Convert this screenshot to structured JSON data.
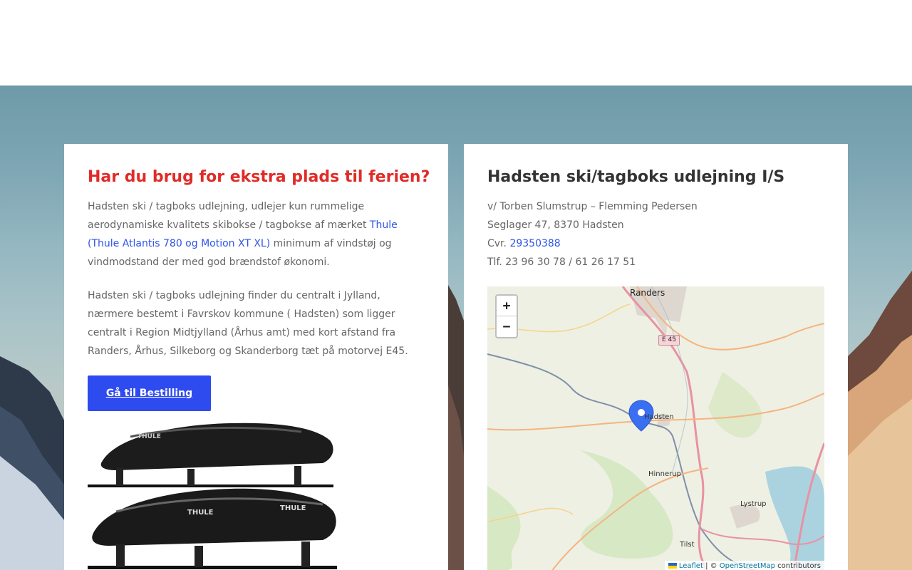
{
  "left_card": {
    "title": "Har du brug for ekstra plads til ferien?",
    "p1_text": "Hadsten ski / tagboks udlejning, udlejer kun rummelige aerodynamiske kvalitets skibokse / tagbokse af mærket ",
    "p1_link": "Thule (Thule Atlantis 780 og Motion XT XL)",
    "p1_tail": " minimum af vindstøj og vindmodstand der med god brændstof økonomi.",
    "p2_text": "Hadsten ski / tagboks udlejning finder du centralt i Jylland, nærmere bestemt i Favrskov kommune ( Hadsten) som ligger centralt i Region Midtjylland (Århus amt) med kort afstand fra Randers, Århus, Silkeborg og Skanderborg tæt på motorvej E45.",
    "button_label": "Gå til Bestilling",
    "product_brand": "THULE"
  },
  "right_card": {
    "title": "Hadsten ski/tagboks udlejning I/S",
    "contact_line1": "v/ Torben Slumstrup – Flemming Pedersen",
    "contact_line2": "Seglager 47, 8370 Hadsten",
    "cvr_label": "Cvr. ",
    "cvr_link": "29350388",
    "phone_line": "Tlf. 23 96 30 78 / 61 26 17 51"
  },
  "map": {
    "zoom_in": "+",
    "zoom_out": "−",
    "labels": {
      "randers": "Randers",
      "hadsten": "Hadsten",
      "hinnerup": "Hinnerup",
      "lystrup": "Lystrup",
      "tilst": "Tilst",
      "e45": "E 45"
    },
    "attribution": {
      "leaflet": "Leaflet",
      "sep": " | © ",
      "osm": "OpenStreetMap",
      "tail": " contributors"
    }
  },
  "colors": {
    "title_red": "#e02b27",
    "link_blue": "#2e54e8",
    "button_blue": "#2e4bf0",
    "marker_blue": "#3b6ff2"
  }
}
